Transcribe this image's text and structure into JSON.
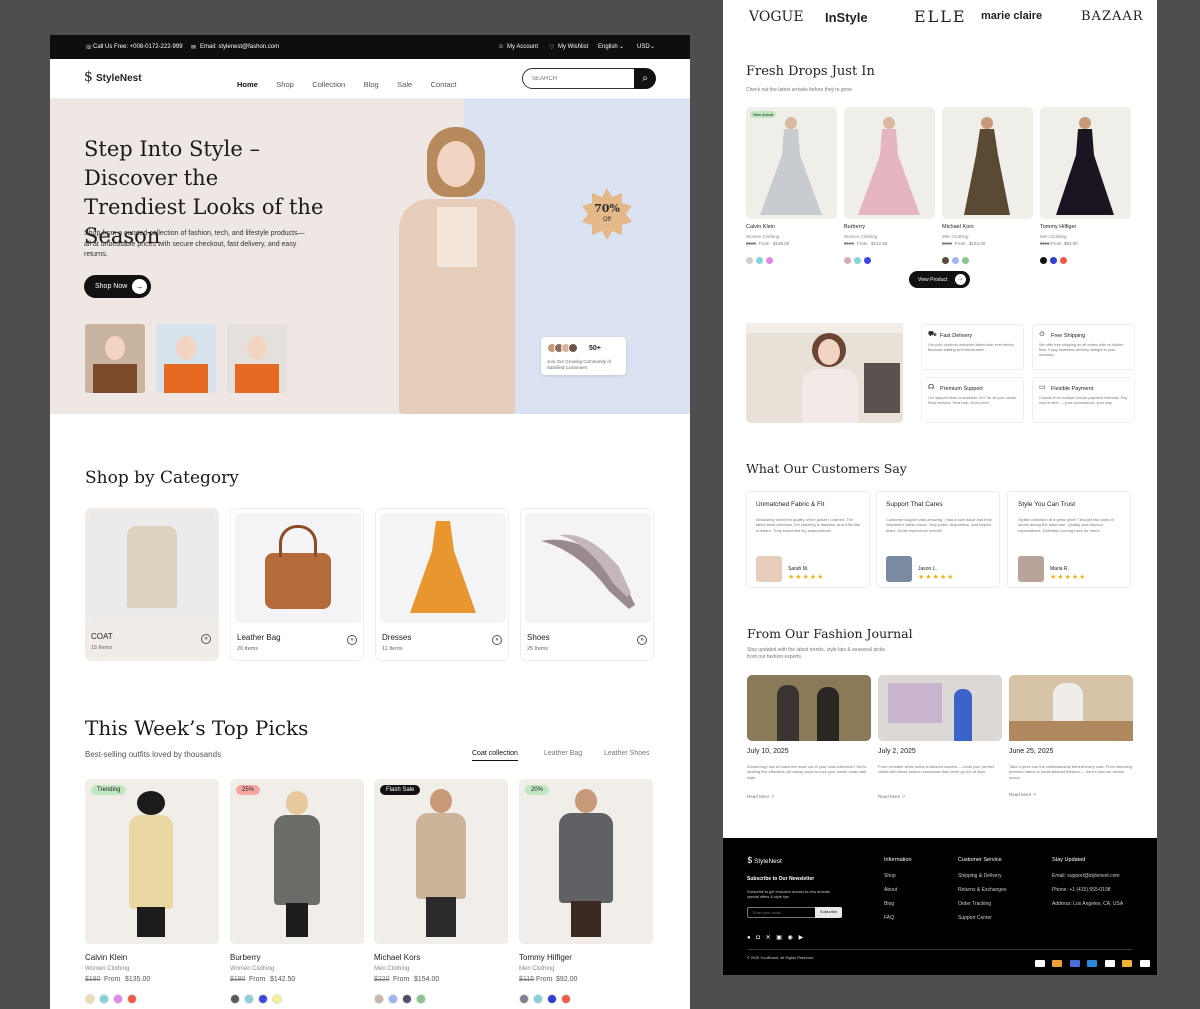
{
  "topbar": {
    "phone": "Call Us Free: +008-0172-222-999",
    "email": "Email: stylenest@fashon.com",
    "account": "My Account",
    "wishlist": "My Wishlist",
    "language": "English",
    "currency": "USD"
  },
  "brand": "StyleNest",
  "nav": [
    "Home",
    "Shop",
    "Collection",
    "Blog",
    "Sale",
    "Contact"
  ],
  "search": {
    "placeholder": "SEARCH"
  },
  "hero": {
    "title": "Step Into Style – Discover the Trendiest Looks of the Season",
    "desc": "Shop from a curated collection of fashion, tech, and lifestyle products—all at unbeatable prices with secure checkout, fast delivery, and easy returns.",
    "cta": "Shop Now",
    "badge_value": "70%",
    "badge_label": "Off",
    "community_count": "50+",
    "community_text": "Join Our Growing Community of Satisfied Customers"
  },
  "categories": {
    "title": "Shop by Category",
    "items": [
      {
        "name": "COAT",
        "count": "15 Items"
      },
      {
        "name": "Leather Bag",
        "count": "20 Items"
      },
      {
        "name": "Dresses",
        "count": "11 Items"
      },
      {
        "name": "Shoes",
        "count": "25 Items"
      }
    ]
  },
  "top_picks": {
    "title": "This Week’s Top Picks",
    "subtitle": "Best-selling outfits loved by thousands",
    "tabs": [
      "Coat collection",
      "Leather Bag",
      "Leather Shoes"
    ],
    "items": [
      {
        "tag": "Trending",
        "brand": "Calvin Klein",
        "category": "Women Clothing",
        "old": "$180",
        "from": "From",
        "price": "$135.00",
        "colors": [
          "#ecdcb2",
          "#88d3d8",
          "#e08ae8",
          "#f05a4a"
        ]
      },
      {
        "tag": "25%",
        "brand": "Burberry",
        "category": "Women Clothing",
        "old": "$190",
        "from": "From",
        "price": "$142.50",
        "colors": [
          "#5a5a5a",
          "#88d3d8",
          "#3a48e0",
          "#f7f08e"
        ]
      },
      {
        "tag": "Flash Sale",
        "brand": "Michael Kors",
        "category": "Men Clothing",
        "old": "$220",
        "from": "From",
        "price": "$154.00",
        "colors": [
          "#c5b8aa",
          "#9fb5f0",
          "#4f4f6a",
          "#8bc28e"
        ]
      },
      {
        "tag": "20%",
        "brand": "Tommy Hilfiger",
        "category": "Men Clothing",
        "old": "$115",
        "from": "From",
        "price": "$92.00",
        "colors": [
          "#808090",
          "#88d3d8",
          "#2f3fd0",
          "#f05a4a"
        ]
      }
    ]
  },
  "brands": [
    "VOGUE",
    "InStyle",
    "ELLE",
    "marie claire",
    "BAZAAR"
  ],
  "fresh": {
    "title": "Fresh Drops Just In",
    "subtitle": "Check out the latest arrivals before they're gone",
    "new_tag": "New Arrival",
    "cta": "View Product",
    "items": [
      {
        "brand": "Calvin Klein",
        "category": "Women Clothing",
        "old": "$180",
        "from": "From",
        "price": "$135.00",
        "colors": [
          "#cfcfcf",
          "#7fd3e0",
          "#e08ae8"
        ]
      },
      {
        "brand": "Burberry",
        "category": "Women Clothing",
        "old": "$190",
        "from": "From",
        "price": "$142.50",
        "colors": [
          "#d7aab8",
          "#88d3d8",
          "#3a48e0"
        ]
      },
      {
        "brand": "Michael Kors",
        "category": "Men Clothing",
        "old": "$220",
        "from": "From",
        "price": "$154.00",
        "colors": [
          "#5a4a3a",
          "#9fb5f0",
          "#8bc28e"
        ]
      },
      {
        "brand": "Tommy Hilfiger",
        "category": "Men Clothing",
        "old": "$115",
        "from": "From",
        "price": "$92.00",
        "colors": [
          "#111111",
          "#2f3fd0",
          "#f05a4a"
        ]
      }
    ]
  },
  "features": [
    {
      "title": "Fast Delivery",
      "text": "Get your products delivered faster than ever before. Because waiting isn't fashionable."
    },
    {
      "title": "Free Shipping",
      "text": "We offer free shipping on all orders with no hidden fees. Enjoy seamless delivery straight to your doorstep."
    },
    {
      "title": "Premium Support",
      "text": "Our support team is available 24/7 for all your needs. Real humans. Real help. Every time."
    },
    {
      "title": "Flexible Payment",
      "text": "Choose from multiple secure payment methods. Pay now or later — your convenience, your way."
    }
  ],
  "reviews": {
    "title": "What Our Customers Say",
    "items": [
      {
        "title": "Unmatched Fabric & Fit",
        "text": "Absolutely loved the quality of the jacket I ordered. The fabric feels premium, the stitching is flawless, and it fits like a dream. Truly exceeded my expectations!",
        "name": "Sarah M.",
        "stars": "★★★★★"
      },
      {
        "title": "Support That Cares",
        "text": "Customer support was amazing. I had a size issue and they resolved it within hours. Very polite, responsive, and helpful team. Great experience overall!",
        "name": "Jason L.",
        "stars": "★★★★★"
      },
      {
        "title": "Style You Can Trust",
        "text": "Stylish collection at a great price! I bought two pairs of shoes during the flash sale. Quality was beyond expectations. Definitely coming back for more!",
        "name": "Maria R.",
        "stars": "★★★★★"
      }
    ]
  },
  "journal": {
    "title": "From Our Fashion Journal",
    "subtitle": "Stay updated with the latest trends, style tips & seasonal picks from our fashion experts.",
    "read_more": "Read More",
    "items": [
      {
        "date": "July 10, 2025",
        "text": "Wondering how to make the most out of your coat collection? We're sharing five effortless yet classy ways to rock your winter coats with style."
      },
      {
        "date": "July 2, 2025",
        "text": "From versatile white shirts to tailored blazers — build your perfect closet with these fashion essentials that never go out of style."
      },
      {
        "date": "June 25, 2025",
        "text": "Take a peek into the craftsmanship behind every coat. From selecting premium fabric to hand-stitched finishes — here's how we deliver luxury."
      }
    ]
  },
  "footer": {
    "brand": "StyleNest",
    "newsletter_title": "Subscribe to Our Newsletter",
    "newsletter_text": "Subscribe to get exclusive access to new arrivals, special offers & style tips",
    "email_placeholder": "Enter your email",
    "subscribe": "Subscribe",
    "col1": {
      "title": "Information",
      "links": [
        "Shop",
        "About",
        "Blog",
        "FAQ"
      ]
    },
    "col2": {
      "title": "Customer Service",
      "links": [
        "Shipping & Delivery",
        "Returns & Exchanges",
        "Order Tracking",
        "Support Center"
      ]
    },
    "col3": {
      "title": "Stay Updated",
      "lines": [
        "Email: support@stylenest.com",
        "Phone: +1 (415) 555-0198",
        "Address: Los Angeles, CA, USA"
      ]
    },
    "copyright": "© 2025 YourBrand. All Rights Reserved"
  },
  "colors": {
    "accent": "#111111",
    "hero_left": "#efe7e3",
    "hero_right": "#dbe3f3",
    "badge": "#e5b88a",
    "star": "#f3b11b"
  }
}
